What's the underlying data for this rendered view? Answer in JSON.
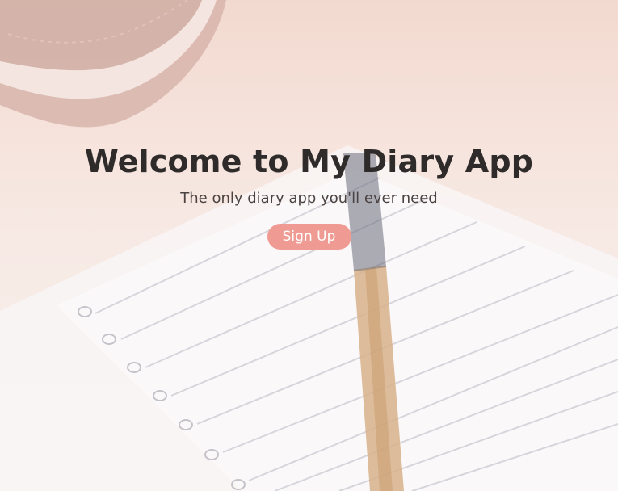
{
  "hero": {
    "title": "Welcome to My Diary App",
    "subtitle": "The only diary app you'll ever need",
    "signup_label": "Sign Up"
  },
  "colors": {
    "button_bg": "#ef9a92",
    "title_text": "#2f2b2a",
    "subtitle_text": "#4b4341"
  },
  "background": {
    "icons": [
      "notebook-image",
      "notepad-image",
      "pencil-image"
    ]
  }
}
